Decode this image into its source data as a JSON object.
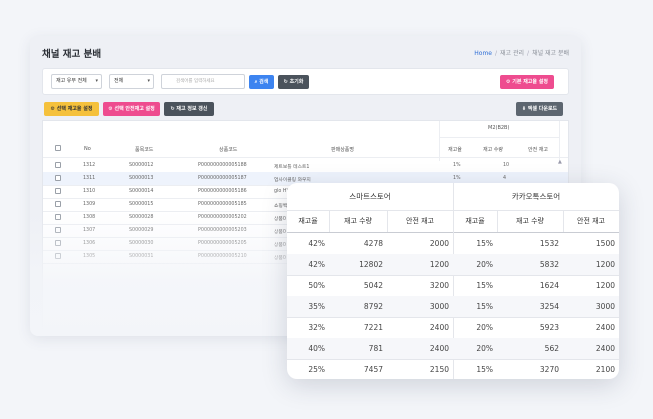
{
  "window": {
    "title": "채널 재고 분배",
    "breadcrumb": [
      "Home",
      "재고 관리",
      "채널 재고 분배"
    ]
  },
  "filters": {
    "select1": "재고 유무 전체",
    "select2": "전체",
    "search_placeholder": "검색어를 입력하세요",
    "search_btn": "검색",
    "reset_btn": "초기화",
    "default_dist_btn": "기본 재고율 설정"
  },
  "actions": {
    "set_ratio": "선택 재고율 설정",
    "set_safe": "선택 안전재고 설정",
    "refresh": "재고 정보 갱신",
    "excel": "엑셀 다운로드"
  },
  "table": {
    "group_m2": "M2(B2B)",
    "headers": [
      "No",
      "품목코드",
      "상품코드",
      "판매상품명",
      "재고율",
      "재고 수량",
      "안전 재고"
    ],
    "rows": [
      {
        "no": "1312",
        "item": "S0000012",
        "product": "P000000000005188",
        "name": "제트보틀 테스트1",
        "ratio": "1%",
        "qty": "10",
        "safe": ""
      },
      {
        "no": "1311",
        "item": "S0000013",
        "product": "P000000000005187",
        "name": "업사이클링 와우지",
        "ratio": "1%",
        "qty": "4",
        "safe": ""
      },
      {
        "no": "1310",
        "item": "S0000014",
        "product": "P000000000005186",
        "name": "glo HYPER Pro limit",
        "ratio": "",
        "qty": "",
        "safe": ""
      },
      {
        "no": "1309",
        "item": "S0000015",
        "product": "P000000000005185",
        "name": "쇼핑백",
        "ratio": "",
        "qty": "",
        "safe": ""
      },
      {
        "no": "1308",
        "item": "S0000028",
        "product": "P000000000005202",
        "name": "상품0",
        "ratio": "",
        "qty": "",
        "safe": ""
      },
      {
        "no": "1307",
        "item": "S0000029",
        "product": "P000000000005203",
        "name": "상품0",
        "ratio": "",
        "qty": "",
        "safe": ""
      },
      {
        "no": "1306",
        "item": "S0000030",
        "product": "P000000000005205",
        "name": "상품0",
        "ratio": "",
        "qty": "",
        "safe": ""
      },
      {
        "no": "1305",
        "item": "S0000031",
        "product": "P000000000005210",
        "name": "상품0",
        "ratio": "",
        "qty": "",
        "safe": ""
      }
    ]
  },
  "overlay": {
    "groups": [
      "스마트스토어",
      "카카오톡스토어"
    ],
    "headers": [
      "재고율",
      "재고 수량",
      "안전 재고",
      "재고율",
      "재고 수량",
      "안전 재고"
    ],
    "rows": [
      [
        "42%",
        "4278",
        "2000",
        "15%",
        "1532",
        "1500"
      ],
      [
        "42%",
        "12802",
        "1200",
        "20%",
        "5832",
        "1200"
      ],
      [
        "50%",
        "5042",
        "3200",
        "15%",
        "1624",
        "1200"
      ],
      [
        "35%",
        "8792",
        "3000",
        "15%",
        "3254",
        "3000"
      ],
      [
        "32%",
        "7221",
        "2400",
        "20%",
        "5923",
        "2400"
      ],
      [
        "40%",
        "781",
        "2400",
        "20%",
        "562",
        "2400"
      ],
      [
        "25%",
        "7457",
        "2150",
        "15%",
        "3270",
        "2100"
      ]
    ]
  }
}
